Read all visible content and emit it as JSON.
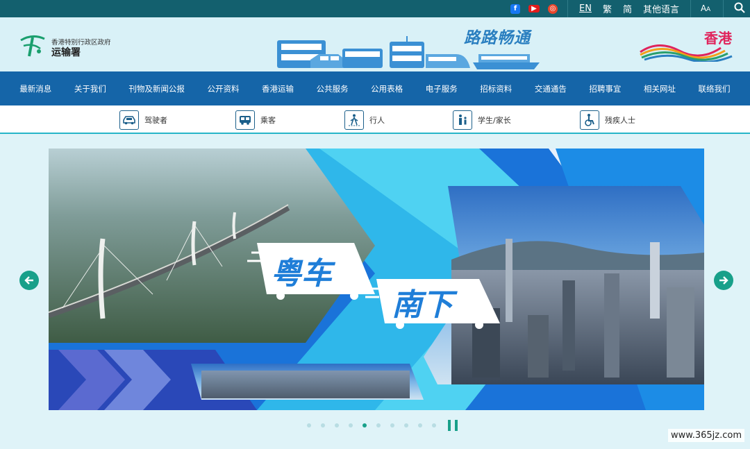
{
  "topbar": {
    "social": [
      "facebook-icon",
      "youtube-icon",
      "weibo-icon"
    ],
    "languages": [
      "EN",
      "繁",
      "简",
      "其他语言"
    ],
    "font_size_label": "A A"
  },
  "header": {
    "dept_small": "香港特别行政区政府",
    "dept_name": "运输署",
    "slogan": "路路畅通",
    "brand": "香港"
  },
  "mainnav": {
    "items": [
      "最新消息",
      "关于我们",
      "刊物及新闻公报",
      "公开资料",
      "香港运输",
      "公共服务",
      "公用表格",
      "电子服务",
      "招标资料",
      "交通通告",
      "招聘事宜",
      "相关网址",
      "联络我们"
    ]
  },
  "audience": {
    "items": [
      "驾驶者",
      "乘客",
      "行人",
      "学生/家长",
      "残疾人士"
    ]
  },
  "banner": {
    "line1": "粤车",
    "line2": "南下"
  },
  "carousel": {
    "total": 10,
    "active_index": 4
  },
  "watermark": "www.365jz.com",
  "colors": {
    "topbar": "#13606e",
    "mainnav": "#1565a8",
    "accent": "#18a08a"
  }
}
